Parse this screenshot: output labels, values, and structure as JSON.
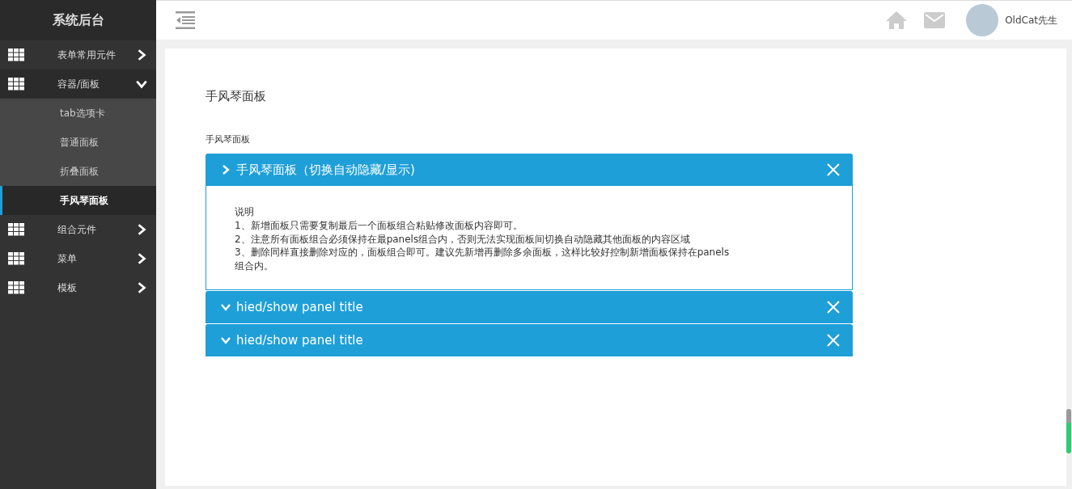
{
  "sidebar": {
    "title": "系统后台",
    "items": [
      {
        "label": "表单常用元件",
        "expanded": false
      },
      {
        "label": "容器/面板",
        "expanded": true,
        "children": [
          {
            "label": "tab选项卡",
            "selected": false
          },
          {
            "label": "普通面板",
            "selected": false
          },
          {
            "label": "折叠面板",
            "selected": false
          },
          {
            "label": "手风琴面板",
            "selected": true
          }
        ]
      },
      {
        "label": "组合元件",
        "expanded": false
      },
      {
        "label": "菜单",
        "expanded": false
      },
      {
        "label": "模板",
        "expanded": false
      }
    ]
  },
  "header": {
    "user": "OldCat先生"
  },
  "page": {
    "title": "手风琴面板",
    "section_label": "手风琴面板",
    "panels": [
      {
        "title": "手风琴面板（切换自动隐藏/显示)",
        "expanded": true,
        "body": [
          "说明",
          "1、新增面板只需要复制最后一个面板组合粘贴修改面板内容即可。",
          "2、注意所有面板组合必须保持在最panels组合内，否则无法实现面板间切换自动隐藏其他面板的内容区域",
          "3、删除同样直接删除对应的，面板组合即可。建议先新增再删除多余面板，这样比较好控制新增面板保持在panels组合内。"
        ]
      },
      {
        "title": "hied/show panel title",
        "expanded": false
      },
      {
        "title": "hied/show panel title",
        "expanded": false
      }
    ]
  }
}
